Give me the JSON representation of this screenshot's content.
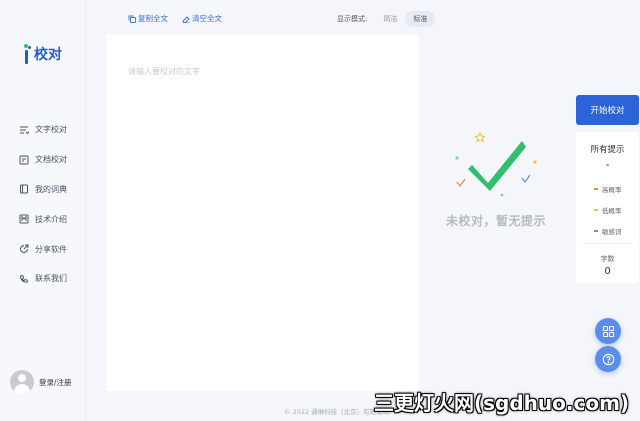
{
  "brand": {
    "logo_text": "校对"
  },
  "nav": {
    "items": [
      {
        "label": "文字校对",
        "icon": "text-proofread-icon"
      },
      {
        "label": "文档校对",
        "icon": "document-proofread-icon"
      },
      {
        "label": "我的词典",
        "icon": "dictionary-icon"
      },
      {
        "label": "技术介绍",
        "icon": "tech-intro-icon"
      },
      {
        "label": "分享软件",
        "icon": "share-icon"
      },
      {
        "label": "联系我们",
        "icon": "phone-icon"
      }
    ]
  },
  "user": {
    "login_label": "登录/注册"
  },
  "toolbar": {
    "copy_label": "复制全文",
    "clear_label": "清空全文",
    "mode_label": "显示模式:",
    "mode_options": [
      "简洁",
      "标准"
    ],
    "mode_selected": "标准"
  },
  "editor": {
    "placeholder": "请输入要校对的文字",
    "value": ""
  },
  "empty_state": {
    "message": "未校对，暂无提示"
  },
  "actions": {
    "start_label": "开始校对"
  },
  "hints": {
    "title": "所有提示",
    "total": "-",
    "categories": [
      {
        "label": "高概率",
        "color": "#f0883a"
      },
      {
        "label": "低概率",
        "color": "#f0c23a"
      },
      {
        "label": "敏感词",
        "color": "#8a9099"
      }
    ],
    "word_count_label": "字数",
    "word_count": "0"
  },
  "footer": {
    "copyright": "© 2022 通琳科技（北京）有限公司"
  },
  "watermark": {
    "text": "三更灯火网(sgdhuo.com)"
  },
  "colors": {
    "primary": "#2c63d9",
    "brand_green": "#2fbf6f",
    "fab": "#5b8def"
  }
}
